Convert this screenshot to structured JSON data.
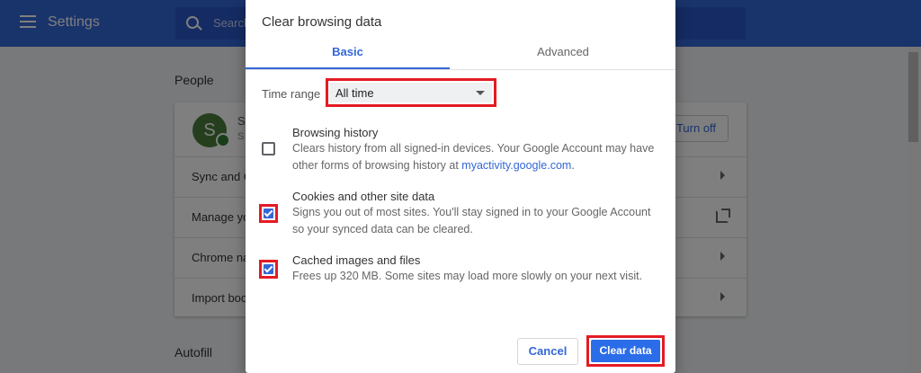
{
  "app": {
    "title": "Settings",
    "search_placeholder": "Search settings",
    "search_visible": "Search"
  },
  "sections": {
    "people": "People",
    "autofill": "Autofill"
  },
  "account": {
    "avatar_letter": "S",
    "name_partial": "S",
    "email_partial": "S",
    "turn_off": "Turn off"
  },
  "rows": [
    {
      "label": "Sync and G"
    },
    {
      "label": "Manage yo"
    },
    {
      "label": "Chrome na"
    },
    {
      "label": "Import boo"
    }
  ],
  "dialog": {
    "title": "Clear browsing data",
    "tabs": {
      "basic": "Basic",
      "advanced": "Advanced"
    },
    "time_range_label": "Time range",
    "time_range_value": "All time",
    "items": [
      {
        "title": "Browsing history",
        "desc_1": "Clears history from all signed-in devices. Your Google Account may have other forms of browsing history at ",
        "link": "myactivity.google.com",
        "desc_2": ".",
        "checked": false
      },
      {
        "title": "Cookies and other site data",
        "desc_1": "Signs you out of most sites. You'll stay signed in to your Google Account so your synced data can be cleared.",
        "checked": true
      },
      {
        "title": "Cached images and files",
        "desc_1": "Frees up 320 MB. Some sites may load more slowly on your next visit.",
        "checked": true
      }
    ],
    "cancel": "Cancel",
    "clear": "Clear data"
  },
  "colors": {
    "accent": "#3367d6",
    "highlight": "#e41b23",
    "topbar": "#3367d6"
  }
}
